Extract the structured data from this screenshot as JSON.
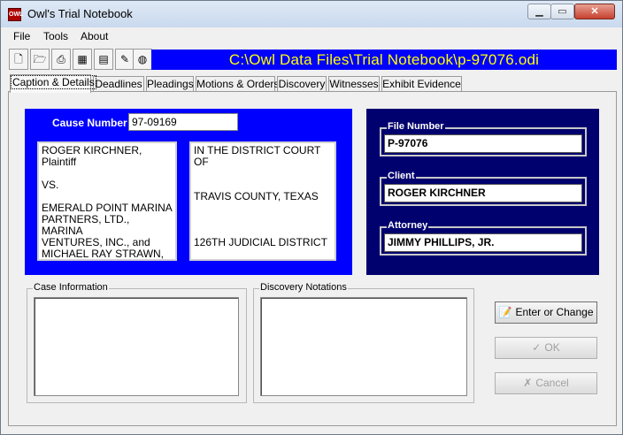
{
  "window": {
    "title": "Owl's Trial Notebook",
    "icon_text": "OWL"
  },
  "menu": [
    "File",
    "Tools",
    "About"
  ],
  "toolbar": {
    "tools": [
      "new-document",
      "open-folder",
      "print",
      "calendar",
      "calculator",
      "notes-magnify",
      "globe"
    ],
    "path": "C:\\Owl Data Files\\Trial Notebook\\p-97076.odi"
  },
  "tabs": [
    "Caption & Details",
    "Deadlines",
    "Pleadings",
    "Motions & Orders",
    "Discovery",
    "Witnesses",
    "Exhibit Evidence"
  ],
  "caption": {
    "cause_label": "Cause Number",
    "cause_number": "97-09169",
    "left_text": "ROGER KIRCHNER,\nPlaintiff\n\nVS.\n\nEMERALD POINT MARINA\nPARTNERS, LTD., MARINA\nVENTURES, INC., and\nMICHAEL RAY STRAWN,",
    "right_text": "IN THE DISTRICT COURT OF\n\n\nTRAVIS COUNTY, TEXAS\n\n\n\n126TH JUDICIAL DISTRICT"
  },
  "file_info": {
    "file_number_label": "File Number",
    "file_number": "P-97076",
    "client_label": "Client",
    "client": "ROGER KIRCHNER",
    "attorney_label": "Attorney",
    "attorney": "JIMMY PHILLIPS, JR."
  },
  "groups": {
    "case_info_label": "Case Information",
    "discovery_label": "Discovery Notations"
  },
  "buttons": {
    "enter_change": "Enter or Change",
    "ok": "OK",
    "cancel": "Cancel"
  }
}
